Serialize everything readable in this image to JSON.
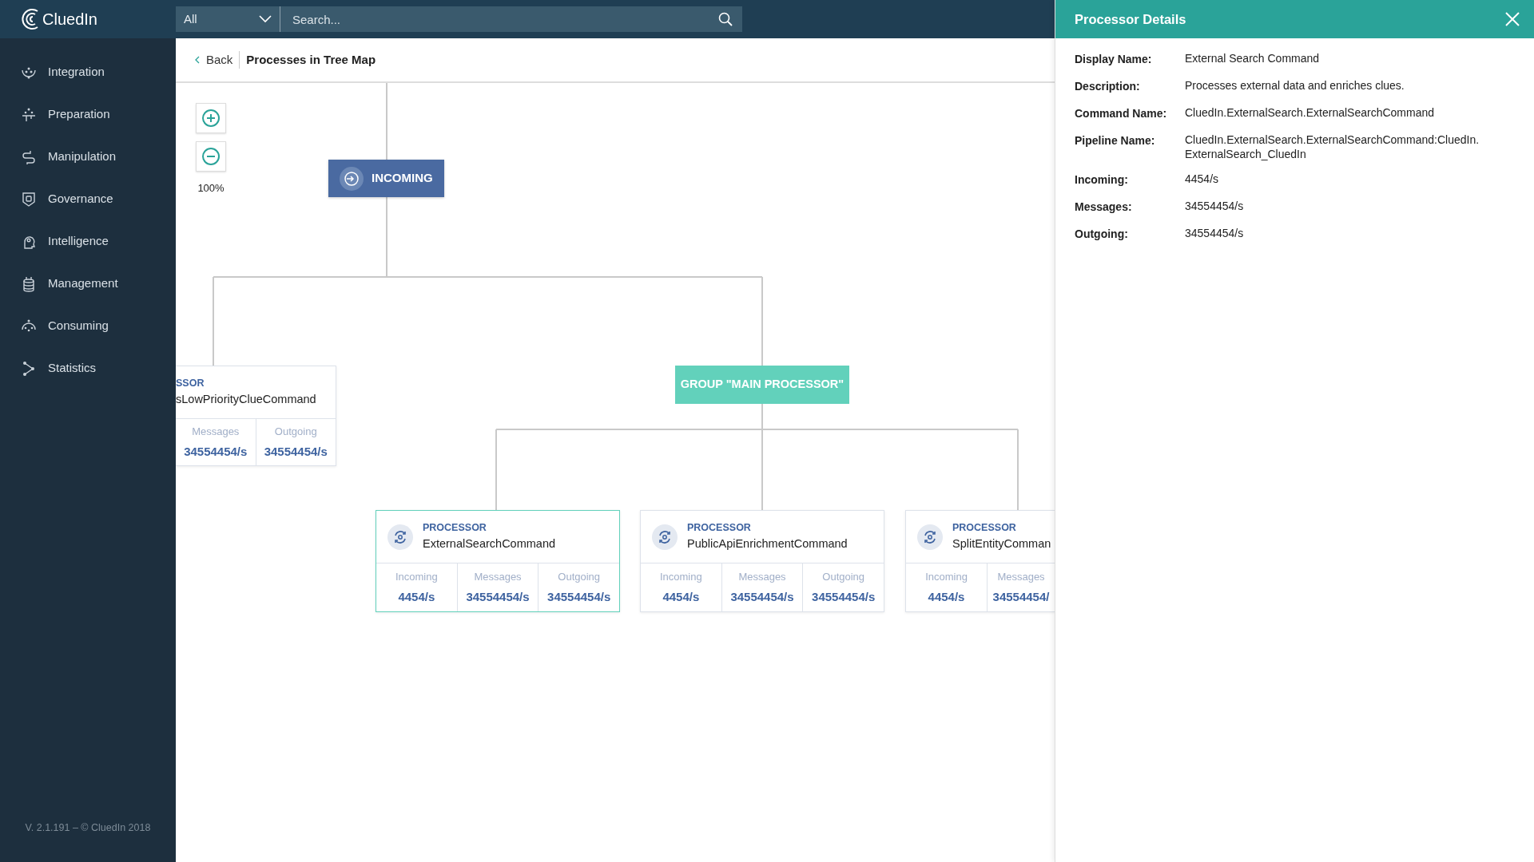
{
  "brand": {
    "name": "CluedIn"
  },
  "search": {
    "scope": "All",
    "placeholder": "Search..."
  },
  "sidebar": {
    "items": [
      {
        "label": "Integration"
      },
      {
        "label": "Preparation"
      },
      {
        "label": "Manipulation"
      },
      {
        "label": "Governance"
      },
      {
        "label": "Intelligence"
      },
      {
        "label": "Management"
      },
      {
        "label": "Consuming"
      },
      {
        "label": "Statistics"
      }
    ],
    "version": "V. 2.1.191 – © CluedIn  2018"
  },
  "breadcrumb": {
    "back": "Back",
    "title": "Processes in Tree Map"
  },
  "zoom": {
    "level_text": "100%"
  },
  "tree": {
    "root": {
      "label": "INCOMING"
    },
    "group": {
      "label": "GROUP \"MAIN PROCESSOR\""
    },
    "processors": [
      {
        "type": "SSOR",
        "name": "sLowPriorityClueCommand",
        "cut_left": true,
        "selected": false,
        "stats": [
          {
            "label": "Messages",
            "value": "34554454/s"
          },
          {
            "label": "Outgoing",
            "value": "34554454/s"
          }
        ]
      },
      {
        "type": "PROCESSOR",
        "name": "ExternalSearchCommand",
        "selected": true,
        "stats": [
          {
            "label": "Incoming",
            "value": "4454/s"
          },
          {
            "label": "Messages",
            "value": "34554454/s"
          },
          {
            "label": "Outgoing",
            "value": "34554454/s"
          }
        ]
      },
      {
        "type": "PROCESSOR",
        "name": "PublicApiEnrichmentCommand",
        "selected": false,
        "stats": [
          {
            "label": "Incoming",
            "value": "4454/s"
          },
          {
            "label": "Messages",
            "value": "34554454/s"
          },
          {
            "label": "Outgoing",
            "value": "34554454/s"
          }
        ]
      },
      {
        "type": "PROCESSOR",
        "name": "SplitEntityComman",
        "cut_right": true,
        "selected": false,
        "stats": [
          {
            "label": "Incoming",
            "value": "4454/s"
          },
          {
            "label": "Messages",
            "value": "34554454/"
          }
        ]
      }
    ]
  },
  "details_panel": {
    "title": "Processor Details",
    "fields": [
      {
        "label": "Display Name:",
        "value": "External Search Command"
      },
      {
        "label": "Description:",
        "value": "Processes external data and enriches clues."
      },
      {
        "label": "Command Name:",
        "value": "CluedIn.ExternalSearch.ExternalSearchCommand"
      },
      {
        "label": "Pipeline Name:",
        "value": "CluedIn.ExternalSearch.ExternalSearchCommand:CluedIn.\nExternalSearch_CluedIn"
      },
      {
        "label": "Incoming:",
        "value": "4454/s"
      },
      {
        "label": "Messages:",
        "value": "34554454/s"
      },
      {
        "label": "Outgoing:",
        "value": "34554454/s"
      }
    ]
  }
}
